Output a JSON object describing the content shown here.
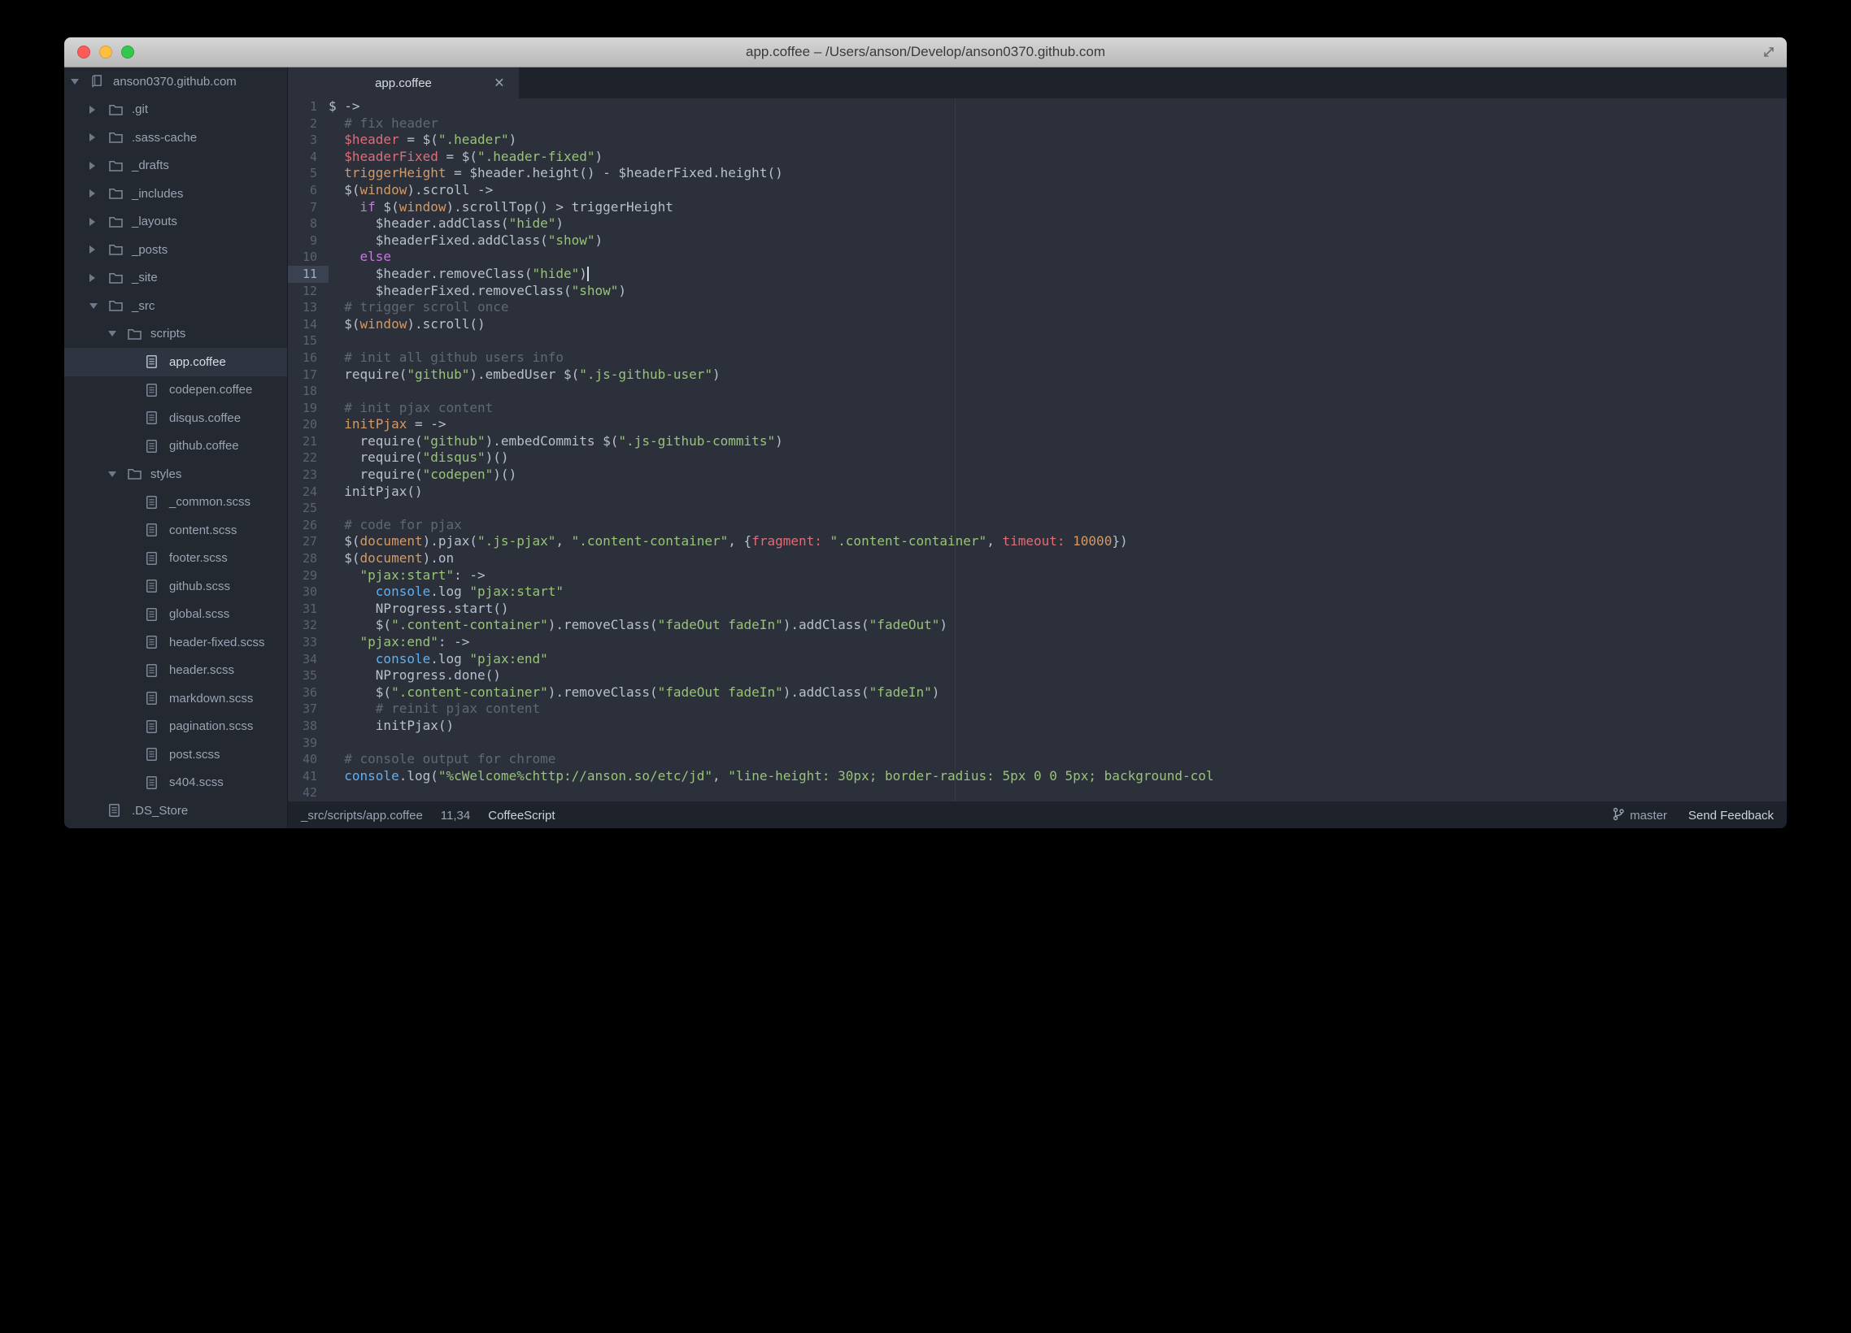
{
  "palette": {
    "bg_editor": "#2b303b",
    "bg_sidebar": "#232831",
    "bg_panel": "#1d222b",
    "bg_selected": "#2e3541",
    "bg_gutter_active": "#3a4252",
    "fg_default": "#b7c0cc",
    "fg_muted": "#9aa4b2",
    "fg_bright": "#d7dce3",
    "gutter": "#5a6372",
    "tok_comment": "#5f6875",
    "tok_red": "#e06c75",
    "tok_orange": "#d19a66",
    "tok_string": "#98c379",
    "tok_keyword": "#c678dd",
    "tok_blue": "#61afef"
  },
  "window": {
    "title": "app.coffee – /Users/anson/Develop/anson0370.github.com"
  },
  "tab": {
    "label": "app.coffee",
    "close_glyph": "×"
  },
  "sidebar": {
    "root": {
      "label": "anson0370.github.com"
    },
    "items": [
      {
        "label": ".git",
        "kind": "folder",
        "depth": 1,
        "expanded": false
      },
      {
        "label": ".sass-cache",
        "kind": "folder",
        "depth": 1,
        "expanded": false
      },
      {
        "label": "_drafts",
        "kind": "folder",
        "depth": 1,
        "expanded": false
      },
      {
        "label": "_includes",
        "kind": "folder",
        "depth": 1,
        "expanded": false
      },
      {
        "label": "_layouts",
        "kind": "folder",
        "depth": 1,
        "expanded": false
      },
      {
        "label": "_posts",
        "kind": "folder",
        "depth": 1,
        "expanded": false
      },
      {
        "label": "_site",
        "kind": "folder",
        "depth": 1,
        "expanded": false
      },
      {
        "label": "_src",
        "kind": "folder",
        "depth": 1,
        "expanded": true
      },
      {
        "label": "scripts",
        "kind": "folder",
        "depth": 2,
        "expanded": true
      },
      {
        "label": "app.coffee",
        "kind": "file",
        "depth": 3,
        "selected": true
      },
      {
        "label": "codepen.coffee",
        "kind": "file",
        "depth": 3
      },
      {
        "label": "disqus.coffee",
        "kind": "file",
        "depth": 3
      },
      {
        "label": "github.coffee",
        "kind": "file",
        "depth": 3
      },
      {
        "label": "styles",
        "kind": "folder",
        "depth": 2,
        "expanded": true
      },
      {
        "label": "_common.scss",
        "kind": "file",
        "depth": 3
      },
      {
        "label": "content.scss",
        "kind": "file",
        "depth": 3
      },
      {
        "label": "footer.scss",
        "kind": "file",
        "depth": 3
      },
      {
        "label": "github.scss",
        "kind": "file",
        "depth": 3
      },
      {
        "label": "global.scss",
        "kind": "file",
        "depth": 3
      },
      {
        "label": "header-fixed.scss",
        "kind": "file",
        "depth": 3
      },
      {
        "label": "header.scss",
        "kind": "file",
        "depth": 3
      },
      {
        "label": "markdown.scss",
        "kind": "file",
        "depth": 3
      },
      {
        "label": "pagination.scss",
        "kind": "file",
        "depth": 3
      },
      {
        "label": "post.scss",
        "kind": "file",
        "depth": 3
      },
      {
        "label": "s404.scss",
        "kind": "file",
        "depth": 3
      },
      {
        "label": ".DS_Store",
        "kind": "file",
        "depth": 1
      }
    ]
  },
  "editor": {
    "cursor": {
      "line": 11,
      "col": 34
    },
    "lines": [
      [
        [
          "p",
          "$ ->"
        ]
      ],
      [
        [
          "c",
          "  # fix header"
        ]
      ],
      [
        [
          "p",
          "  "
        ],
        [
          "r",
          "$header"
        ],
        [
          "p",
          " = $("
        ],
        [
          "s",
          "\".header\""
        ],
        [
          "p",
          ")"
        ]
      ],
      [
        [
          "p",
          "  "
        ],
        [
          "r",
          "$headerFixed"
        ],
        [
          "p",
          " = $("
        ],
        [
          "s",
          "\".header-fixed\""
        ],
        [
          "p",
          ")"
        ]
      ],
      [
        [
          "p",
          "  "
        ],
        [
          "o",
          "triggerHeight"
        ],
        [
          "p",
          " = $header.height() - $headerFixed.height()"
        ]
      ],
      [
        [
          "p",
          "  $("
        ],
        [
          "o",
          "window"
        ],
        [
          "p",
          ").scroll ->"
        ]
      ],
      [
        [
          "p",
          "    "
        ],
        [
          "k",
          "if"
        ],
        [
          "p",
          " $("
        ],
        [
          "o",
          "window"
        ],
        [
          "p",
          ").scrollTop() > triggerHeight"
        ]
      ],
      [
        [
          "p",
          "      $header.addClass("
        ],
        [
          "s",
          "\"hide\""
        ],
        [
          "p",
          ")"
        ]
      ],
      [
        [
          "p",
          "      $headerFixed.addClass("
        ],
        [
          "s",
          "\"show\""
        ],
        [
          "p",
          ")"
        ]
      ],
      [
        [
          "p",
          "    "
        ],
        [
          "k",
          "else"
        ]
      ],
      [
        [
          "p",
          "      $header.removeClass("
        ],
        [
          "s",
          "\"hide\""
        ],
        [
          "p",
          ")"
        ]
      ],
      [
        [
          "p",
          "      $headerFixed.removeClass("
        ],
        [
          "s",
          "\"show\""
        ],
        [
          "p",
          ")"
        ]
      ],
      [
        [
          "c",
          "  # trigger scroll once"
        ]
      ],
      [
        [
          "p",
          "  $("
        ],
        [
          "o",
          "window"
        ],
        [
          "p",
          ").scroll()"
        ]
      ],
      [],
      [
        [
          "c",
          "  # init all github users info"
        ]
      ],
      [
        [
          "p",
          "  require("
        ],
        [
          "s",
          "\"github\""
        ],
        [
          "p",
          ").embedUser $("
        ],
        [
          "s",
          "\".js-github-user\""
        ],
        [
          "p",
          ")"
        ]
      ],
      [],
      [
        [
          "c",
          "  # init pjax content"
        ]
      ],
      [
        [
          "p",
          "  "
        ],
        [
          "o",
          "initPjax"
        ],
        [
          "p",
          " = ->"
        ]
      ],
      [
        [
          "p",
          "    require("
        ],
        [
          "s",
          "\"github\""
        ],
        [
          "p",
          ").embedCommits $("
        ],
        [
          "s",
          "\".js-github-commits\""
        ],
        [
          "p",
          ")"
        ]
      ],
      [
        [
          "p",
          "    require("
        ],
        [
          "s",
          "\"disqus\""
        ],
        [
          "p",
          ")()"
        ]
      ],
      [
        [
          "p",
          "    require("
        ],
        [
          "s",
          "\"codepen\""
        ],
        [
          "p",
          ")()"
        ]
      ],
      [
        [
          "p",
          "  initPjax()"
        ]
      ],
      [],
      [
        [
          "c",
          "  # code for pjax"
        ]
      ],
      [
        [
          "p",
          "  $("
        ],
        [
          "o",
          "document"
        ],
        [
          "p",
          ").pjax("
        ],
        [
          "s",
          "\".js-pjax\""
        ],
        [
          "p",
          ", "
        ],
        [
          "s",
          "\".content-container\""
        ],
        [
          "p",
          ", {"
        ],
        [
          "r",
          "fragment:"
        ],
        [
          "p",
          " "
        ],
        [
          "s",
          "\".content-container\""
        ],
        [
          "p",
          ", "
        ],
        [
          "r",
          "timeout:"
        ],
        [
          "p",
          " "
        ],
        [
          "n",
          "10000"
        ],
        [
          "p",
          "})"
        ]
      ],
      [
        [
          "p",
          "  $("
        ],
        [
          "o",
          "document"
        ],
        [
          "p",
          ").on"
        ]
      ],
      [
        [
          "p",
          "    "
        ],
        [
          "s",
          "\"pjax:start\""
        ],
        [
          "p",
          ": ->"
        ]
      ],
      [
        [
          "p",
          "      "
        ],
        [
          "b",
          "console"
        ],
        [
          "p",
          ".log "
        ],
        [
          "s",
          "\"pjax:start\""
        ]
      ],
      [
        [
          "p",
          "      NProgress.start()"
        ]
      ],
      [
        [
          "p",
          "      $("
        ],
        [
          "s",
          "\".content-container\""
        ],
        [
          "p",
          ").removeClass("
        ],
        [
          "s",
          "\"fadeOut fadeIn\""
        ],
        [
          "p",
          ").addClass("
        ],
        [
          "s",
          "\"fadeOut\""
        ],
        [
          "p",
          ")"
        ]
      ],
      [
        [
          "p",
          "    "
        ],
        [
          "s",
          "\"pjax:end\""
        ],
        [
          "p",
          ": ->"
        ]
      ],
      [
        [
          "p",
          "      "
        ],
        [
          "b",
          "console"
        ],
        [
          "p",
          ".log "
        ],
        [
          "s",
          "\"pjax:end\""
        ]
      ],
      [
        [
          "p",
          "      NProgress.done()"
        ]
      ],
      [
        [
          "p",
          "      $("
        ],
        [
          "s",
          "\".content-container\""
        ],
        [
          "p",
          ").removeClass("
        ],
        [
          "s",
          "\"fadeOut fadeIn\""
        ],
        [
          "p",
          ").addClass("
        ],
        [
          "s",
          "\"fadeIn\""
        ],
        [
          "p",
          ")"
        ]
      ],
      [
        [
          "c",
          "      # reinit pjax content"
        ]
      ],
      [
        [
          "p",
          "      initPjax()"
        ]
      ],
      [],
      [
        [
          "c",
          "  # console output for chrome"
        ]
      ],
      [
        [
          "p",
          "  "
        ],
        [
          "b",
          "console"
        ],
        [
          "p",
          ".log("
        ],
        [
          "s",
          "\"%cWelcome%chttp://anson.so/etc/jd\""
        ],
        [
          "p",
          ", "
        ],
        [
          "s",
          "\"line-height: 30px; border-radius: 5px 0 0 5px; background-col"
        ]
      ],
      []
    ]
  },
  "status": {
    "path": "_src/scripts/app.coffee",
    "position": "11,34",
    "grammar": "CoffeeScript",
    "branch": "master",
    "feedback": "Send Feedback"
  }
}
